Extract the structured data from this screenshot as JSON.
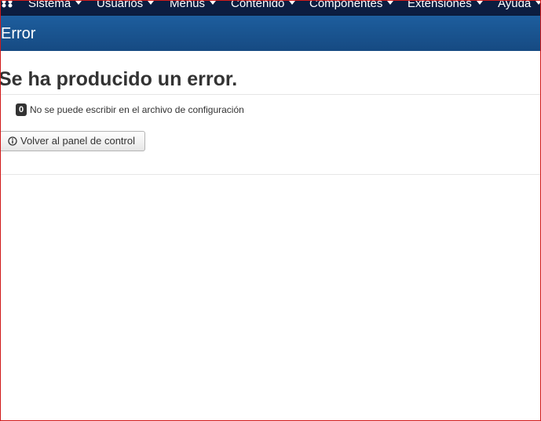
{
  "navbar": {
    "logo_icon": "joomla-logo-icon",
    "items": [
      {
        "label": "Sistema"
      },
      {
        "label": "Usuarios"
      },
      {
        "label": "Menús"
      },
      {
        "label": "Contenido"
      },
      {
        "label": "Componentes"
      },
      {
        "label": "Extensiones"
      },
      {
        "label": "Ayuda"
      }
    ]
  },
  "header": {
    "title": "Error"
  },
  "main": {
    "heading": "Se ha producido un error.",
    "error_code": "0",
    "error_message": "No se puede escribir en el archivo de configuración",
    "back_button_icon": "info-circle-icon",
    "back_button_label": "Volver al panel de control"
  },
  "colors": {
    "navbar_bg": "#0c1d40",
    "header_bg": "#164a82",
    "frame_border": "#d11a1a"
  }
}
